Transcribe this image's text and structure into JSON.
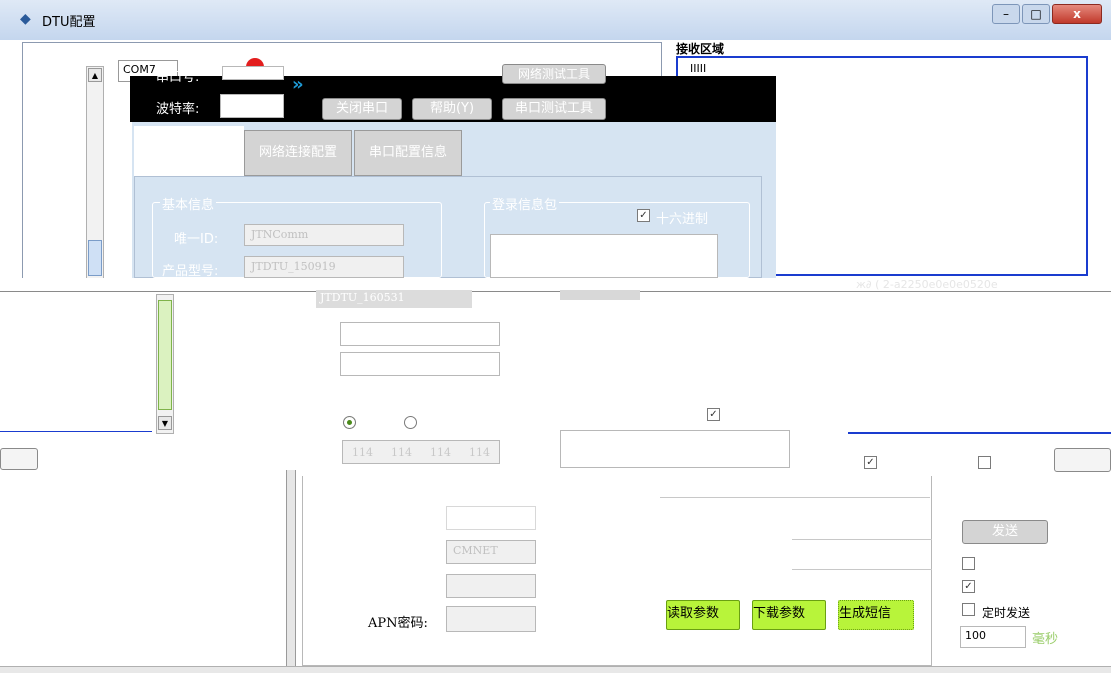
{
  "window": {
    "title": "DTU配置",
    "minimize": "–",
    "maximize": "□",
    "close": "x"
  },
  "receive_area": {
    "label": "接收区域",
    "top_text": "IIIII",
    "bottom_text": "ж∂ (  2-а2250е0е0е0520е"
  },
  "serial": {
    "port_label": "串口号:",
    "baud_label": "波特率:",
    "port_value": "COM7"
  },
  "toolbar": {
    "net_test_label": "网络测试工具",
    "close_port_label": "关闭串口",
    "help_label": "帮助(Y)",
    "serial_test_label": "串口测试工具",
    "arrow": "»"
  },
  "tabs": [
    {
      "label": "网络连接配置"
    },
    {
      "label": "串口配置信息"
    }
  ],
  "basic_info": {
    "legend": "基本信息",
    "id_label": "唯一ID:",
    "id_value": "JTNComm",
    "model_label": "产品型号:",
    "model_value": "JTDTU_150919",
    "version_value": "JTDTU_160531"
  },
  "login_packet": {
    "legend": "登录信息包",
    "hex_label": "十六进制",
    "hex_checked": true
  },
  "ip_segments": [
    "114",
    "114",
    "114",
    "114"
  ],
  "apn": {
    "name_value": "CMNET",
    "password_label": "APN密码:"
  },
  "actions": {
    "read_label": "读取参数",
    "download_label": "下载参数",
    "sms_label": "生成短信"
  },
  "send": {
    "send_label": "发送",
    "timed_label": "定时发送",
    "interval_value": "100",
    "unit_label": "毫秒"
  }
}
